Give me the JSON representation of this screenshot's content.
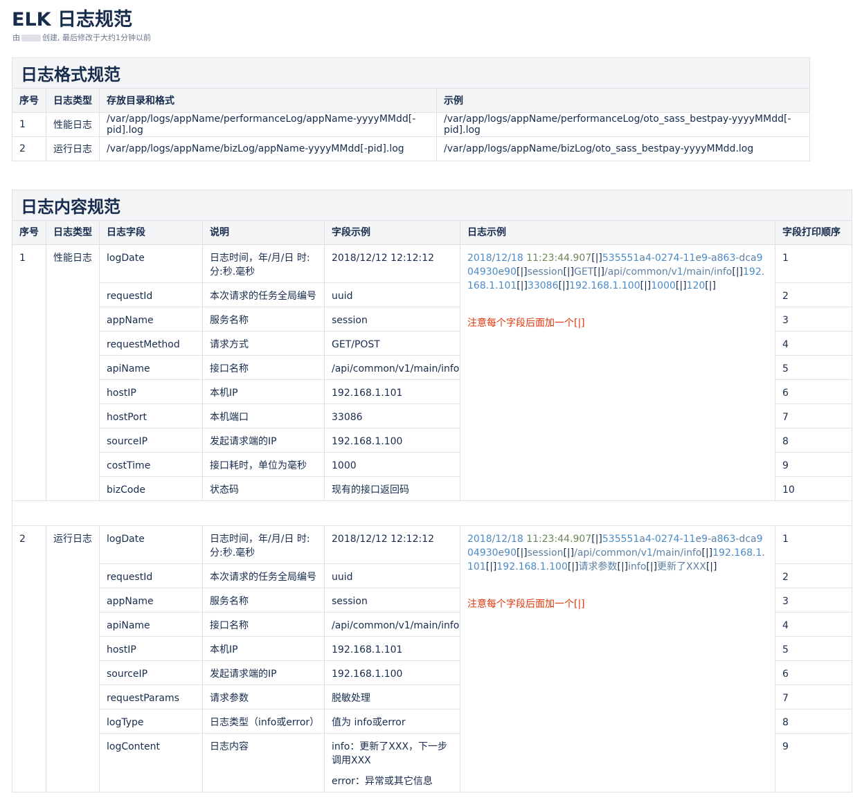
{
  "page": {
    "title": "ELK 日志规范",
    "meta_prefix": "由",
    "meta_suffix": "创建, 最后修改于大约1分钟以前"
  },
  "format": {
    "title": "日志格式规范",
    "headers": [
      "序号",
      "日志类型",
      "存放目录和格式",
      "示例"
    ],
    "rows": [
      [
        "1",
        "性能日志",
        "/var/app/logs/appName/performanceLog/appName-yyyyMMdd[-pid].log",
        "/var/app/logs/appName/performanceLog/oto_sass_bestpay-yyyyMMdd[-pid].log"
      ],
      [
        "2",
        "运行日志",
        "/var/app/logs/appName/bizLog/appName-yyyyMMdd[-pid].log",
        "/var/app/logs/appName/bizLog/oto_sass_bestpay-yyyyMMdd.log"
      ]
    ]
  },
  "content": {
    "title": "日志内容规范",
    "headers": [
      "序号",
      "日志类型",
      "日志字段",
      "说明",
      "字段示例",
      "日志示例",
      "字段打印顺序"
    ],
    "perf": {
      "no": "1",
      "type": "性能日志",
      "rows": [
        [
          "logDate",
          "日志时间，年/月/日 时:分:秒.毫秒",
          "2018/12/12 12:12:12",
          "1"
        ],
        [
          "requestId",
          "本次请求的任务全局编号",
          "uuid",
          "2"
        ],
        [
          "appName",
          "服务名称",
          "session",
          "3"
        ],
        [
          "requestMethod",
          "请求方式",
          "GET/POST",
          "4"
        ],
        [
          "apiName",
          "接口名称",
          "/api/common/v1/main/info",
          "5"
        ],
        [
          "hostIP",
          "本机IP",
          "192.168.1.101",
          "6"
        ],
        [
          "hostPort",
          "本机端口",
          "33086",
          "7"
        ],
        [
          "sourceIP",
          "发起请求端的IP",
          "192.168.1.100",
          "8"
        ],
        [
          "costTime",
          "接口耗时，单位为毫秒",
          "1000",
          "9"
        ],
        [
          "bizCode",
          "状态码",
          "现有的接口返回码",
          "10"
        ]
      ],
      "example": "2018/12/18 11:23:44.907[|]535551a4-0274-11e9-a863-dca904930e90[|]session[|]GET[|]/api/common/v1/main/info[|]192.168.1.101[|]33086[|]192.168.1.100[|]1000[|]120[|]",
      "note": "注意每个字段后面加一个[|]"
    },
    "biz": {
      "no": "2",
      "type": "运行日志",
      "rows": [
        [
          "logDate",
          "日志时间，年/月/日 时:分:秒.毫秒",
          "2018/12/12 12:12:12",
          "1"
        ],
        [
          "requestId",
          "本次请求的任务全局编号",
          "uuid",
          "2"
        ],
        [
          "appName",
          "服务名称",
          "session",
          "3"
        ],
        [
          "apiName",
          "接口名称",
          "/api/common/v1/main/info",
          "4"
        ],
        [
          "hostIP",
          "本机IP",
          "192.168.1.101",
          "5"
        ],
        [
          "sourceIP",
          "发起请求端的IP",
          "192.168.1.100",
          "6"
        ],
        [
          "requestParams",
          "请求参数",
          "脱敏处理",
          "7"
        ],
        [
          "logType",
          "日志类型（info或error）",
          "值为 info或error",
          "8"
        ],
        [
          "logContent",
          "日志内容",
          "info：更新了XXX，下一步调用XXX",
          "9"
        ]
      ],
      "last_extra": "error：异常或其它信息",
      "example": "2018/12/18 11:23:44.907[|]535551a4-0274-11e9-a863-dca904930e90[|]session[|]/api/common/v1/main/info[|]192.168.1.101[|]192.168.1.100[|]请求参数[|]info[|]更新了XXX[|]",
      "note": "注意每个字段后面加一个[|]"
    }
  }
}
